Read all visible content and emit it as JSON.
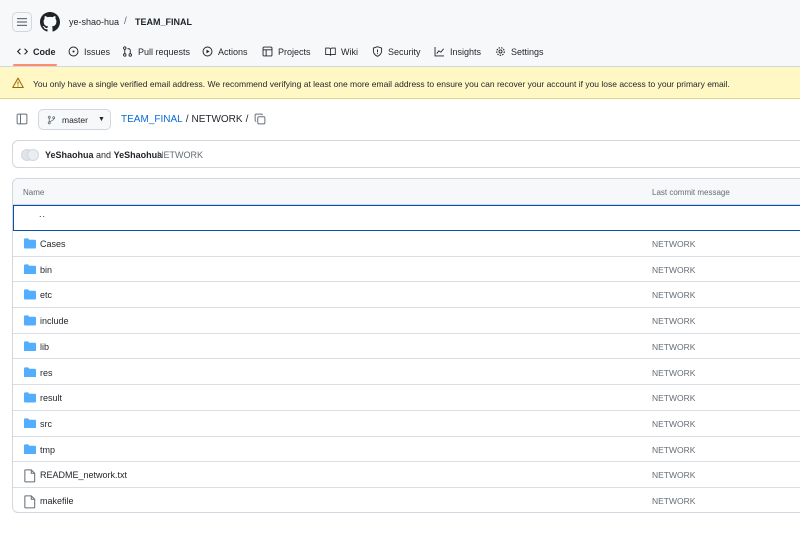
{
  "header": {
    "owner": "ye-shao-hua",
    "separator": "/",
    "repo": "TEAM_FINAL"
  },
  "tabs": [
    {
      "label": "Code",
      "icon": "code-icon",
      "active": true
    },
    {
      "label": "Issues",
      "icon": "issue-icon"
    },
    {
      "label": "Pull requests",
      "icon": "pull-request-icon"
    },
    {
      "label": "Actions",
      "icon": "play-icon"
    },
    {
      "label": "Projects",
      "icon": "table-icon"
    },
    {
      "label": "Wiki",
      "icon": "book-icon"
    },
    {
      "label": "Security",
      "icon": "shield-icon"
    },
    {
      "label": "Insights",
      "icon": "graph-icon"
    },
    {
      "label": "Settings",
      "icon": "gear-icon"
    }
  ],
  "banner": {
    "message": "You only have a single verified email address. We recommend verifying at least one more email address to ensure you can recover your account if you lose access to your primary email.",
    "color": "#fff8c5"
  },
  "file_nav": {
    "branch": "master",
    "path_repo": "TEAM_FINAL",
    "path_sep": "/",
    "path_dir": "NETWORK",
    "path_trailing": "/"
  },
  "commit": {
    "author1": "YeShaohua",
    "conjunction": "and",
    "author2": "YeShaohua",
    "message": "NETWORK"
  },
  "table": {
    "col_name": "Name",
    "col_message": "Last commit message",
    "parent_label": "..",
    "rows": [
      {
        "name": "Cases",
        "type": "folder",
        "message": "NETWORK"
      },
      {
        "name": "bin",
        "type": "folder",
        "message": "NETWORK"
      },
      {
        "name": "etc",
        "type": "folder",
        "message": "NETWORK"
      },
      {
        "name": "include",
        "type": "folder",
        "message": "NETWORK"
      },
      {
        "name": "lib",
        "type": "folder",
        "message": "NETWORK"
      },
      {
        "name": "res",
        "type": "folder",
        "message": "NETWORK"
      },
      {
        "name": "result",
        "type": "folder",
        "message": "NETWORK"
      },
      {
        "name": "src",
        "type": "folder",
        "message": "NETWORK"
      },
      {
        "name": "tmp",
        "type": "folder",
        "message": "NETWORK"
      },
      {
        "name": "README_network.txt",
        "type": "file",
        "message": "NETWORK"
      },
      {
        "name": "makefile",
        "type": "file",
        "message": "NETWORK"
      }
    ]
  },
  "colors": {
    "link": "#0969da",
    "folder": "#54aeff",
    "active_tab_underline": "#fd8c73"
  }
}
